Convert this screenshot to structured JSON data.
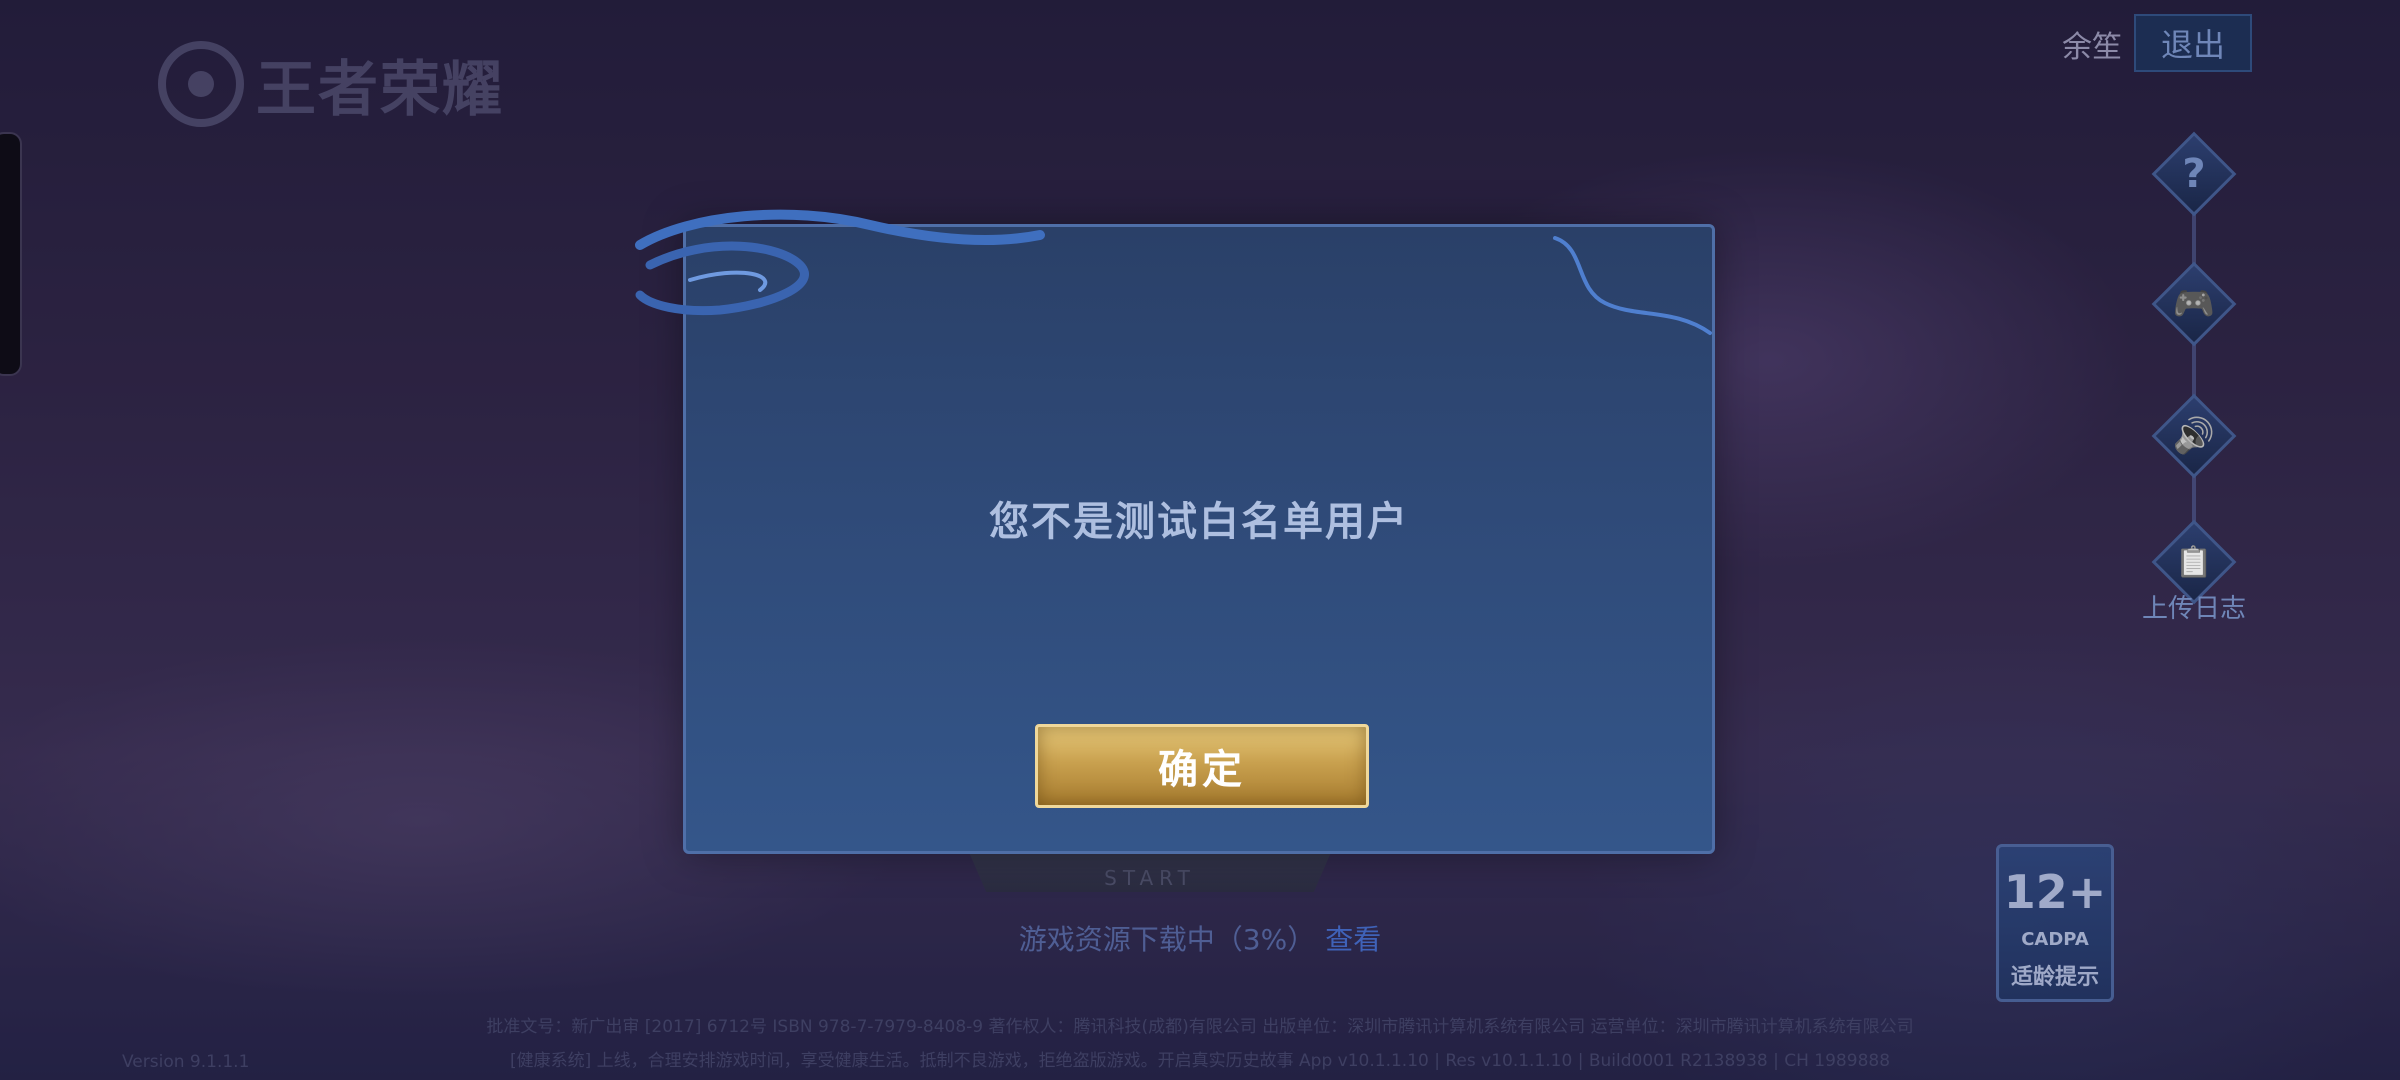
{
  "logo": {
    "text": "王者荣耀"
  },
  "header": {
    "user_name": "余笙",
    "logout_label": "退出"
  },
  "side_menu": {
    "help_glyph": "?",
    "gamepad_glyph": "🎮",
    "sound_glyph": "🔊",
    "log_glyph": "📋",
    "upload_log_label": "上传日志"
  },
  "modal": {
    "message": "您不是测试白名单用户",
    "confirm_label": "确定"
  },
  "background": {
    "start_sub": "START",
    "download_status": "游戏资源下载中（3%）",
    "view_link": "查看"
  },
  "age_rating": {
    "number": "12+",
    "org": "CADPA",
    "hint": "适龄提示"
  },
  "footer": {
    "line1": "批准文号：新广出审 [2017] 6712号  ISBN 978-7-7979-8408-9  著作权人：腾讯科技(成都)有限公司  出版单位：深圳市腾讯计算机系统有限公司  运营单位：深圳市腾讯计算机系统有限公司",
    "line2": "[健康系统] 上线，合理安排游戏时间，享受健康生活。抵制不良游戏，拒绝盗版游戏。开启真实历史故事 App v10.1.1.10 | Res v10.1.1.10 | Build0001 R2138938 | CH 1989888",
    "version": "Version 9.1.1.1"
  }
}
